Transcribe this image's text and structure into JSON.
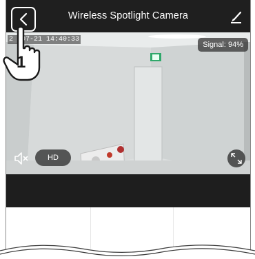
{
  "header": {
    "title": "Wireless Spotlight Camera",
    "back_icon": "chevron-left-icon",
    "edit_icon": "pencil-icon"
  },
  "video": {
    "timestamp": "2 -07-21 14:40:33",
    "signal_label": "Signal: 94%",
    "hd_label": "HD",
    "mute_icon": "speaker-muted-icon",
    "fullscreen_icon": "expand-icon"
  },
  "callout": {
    "step_number": "1"
  },
  "colors": {
    "topbar": "#1f1f1f",
    "band": "#1e1e1e",
    "overlay": "#333333"
  }
}
